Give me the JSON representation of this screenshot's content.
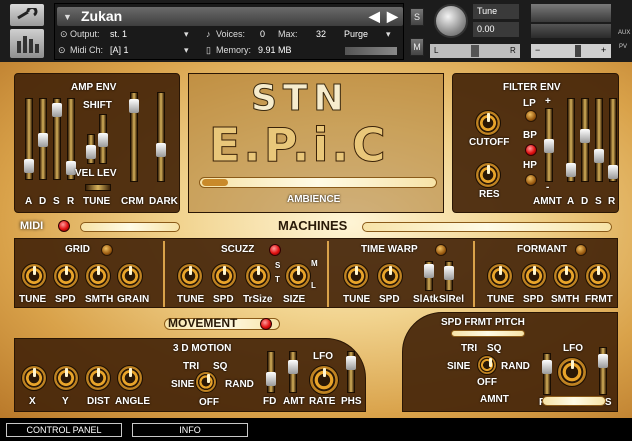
{
  "header": {
    "instrument_name": "Zukan",
    "output_label": "Output:",
    "output_value": "st. 1",
    "voices_label": "Voices:",
    "voices_value": "0",
    "max_label": "Max:",
    "max_value": "32",
    "purge_label": "Purge",
    "midi_label": "Midi Ch:",
    "midi_value": "[A] 1",
    "memory_label": "Memory:",
    "memory_value": "9.91 MB",
    "solo_label": "S",
    "mute_label": "M",
    "tune_label": "Tune",
    "tune_value": "0.00",
    "pan_left": "L",
    "pan_right": "R",
    "aux_label": "AUX",
    "pv_label": "PV"
  },
  "amp_env": {
    "title": "AMP ENV",
    "shift_label": "SHIFT",
    "vel_lev_label": "VEL LEV",
    "tune_label": "TUNE",
    "crm_label": "CRM",
    "dark_label": "DARK",
    "adsr": [
      "A",
      "D",
      "S",
      "R"
    ]
  },
  "logo": {
    "line1": "STN",
    "line2": "E.P.i.C",
    "ambience_label": "AMBIENCE"
  },
  "filter_env": {
    "title": "FILTER ENV",
    "cutoff_label": "CUTOFF",
    "res_label": "RES",
    "lp_label": "LP",
    "bp_label": "BP",
    "hp_label": "HP",
    "plus_label": "+",
    "minus_label": "-",
    "amnt_label": "AMNT",
    "adsr": [
      "A",
      "D",
      "S",
      "R"
    ]
  },
  "midi_label": "MIDI",
  "machines_label": "MACHINES",
  "grid": {
    "title": "GRID",
    "knobs": [
      "TUNE",
      "SPD",
      "SMTH",
      "GRAIN"
    ]
  },
  "scuzz": {
    "title": "SCUZZ",
    "knobs": [
      "TUNE",
      "SPD",
      "TrSize",
      "SIZE"
    ],
    "s_label": "S",
    "t_label": "T",
    "m_label": "M",
    "l_label": "L"
  },
  "time_warp": {
    "title": "TIME WARP",
    "knobs": [
      "TUNE",
      "SPD"
    ],
    "sliders": [
      "SlAtk",
      "SlRel"
    ]
  },
  "formant": {
    "title": "FORMANT",
    "knobs": [
      "TUNE",
      "SPD",
      "SMTH",
      "FRMT"
    ]
  },
  "movement": {
    "title": "MOVEMENT",
    "motion_title": "3 D MOTION",
    "knobs": [
      "X",
      "Y",
      "DIST",
      "ANGLE"
    ],
    "lfo_shapes": {
      "tri": "TRI",
      "sq": "SQ",
      "sine": "SINE",
      "rand": "RAND",
      "off": "OFF"
    },
    "lfo_title": "LFO",
    "lfo_controls": [
      "FD",
      "AMT",
      "RATE",
      "PHS"
    ]
  },
  "right_lfo": {
    "mod_targets": "SPD FRMT PITCH",
    "lfo_shapes": {
      "tri": "TRI",
      "sq": "SQ",
      "sine": "SINE",
      "rand": "RAND",
      "off": "OFF"
    },
    "lfo_title": "LFO",
    "controls": [
      "FD",
      "RATE",
      "PHS"
    ],
    "amnt_label": "AMNT"
  },
  "footer": {
    "tab1": "CONTROL PANEL",
    "tab2": "INFO"
  },
  "colors": {
    "panel_brown": "#46260a",
    "gold": "#f1d38e",
    "led_red": "#e01010"
  }
}
